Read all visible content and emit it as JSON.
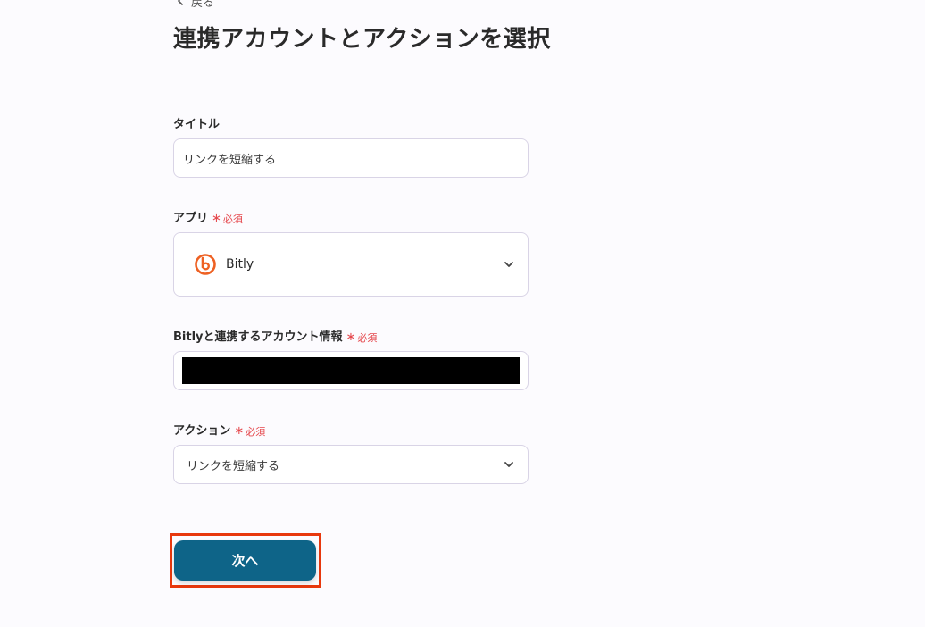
{
  "header": {
    "back_label": "戻る",
    "title": "連携アカウントとアクションを選択"
  },
  "form": {
    "title_field": {
      "label": "タイトル",
      "value": "リンクを短縮する"
    },
    "app_field": {
      "label": "アプリ",
      "required_text": "必須",
      "value": "Bitly",
      "icon": "bitly-logo"
    },
    "account_field": {
      "label": "Bitlyと連携するアカウント情報",
      "required_text": "必須"
    },
    "action_field": {
      "label": "アクション",
      "required_text": "必須",
      "value": "リンクを短縮する"
    }
  },
  "footer": {
    "next_label": "次へ"
  },
  "colors": {
    "primary_button": "#0e6488",
    "highlight_border": "#e8380d",
    "required": "#e5484d",
    "bitly_orange": "#ee6123"
  }
}
